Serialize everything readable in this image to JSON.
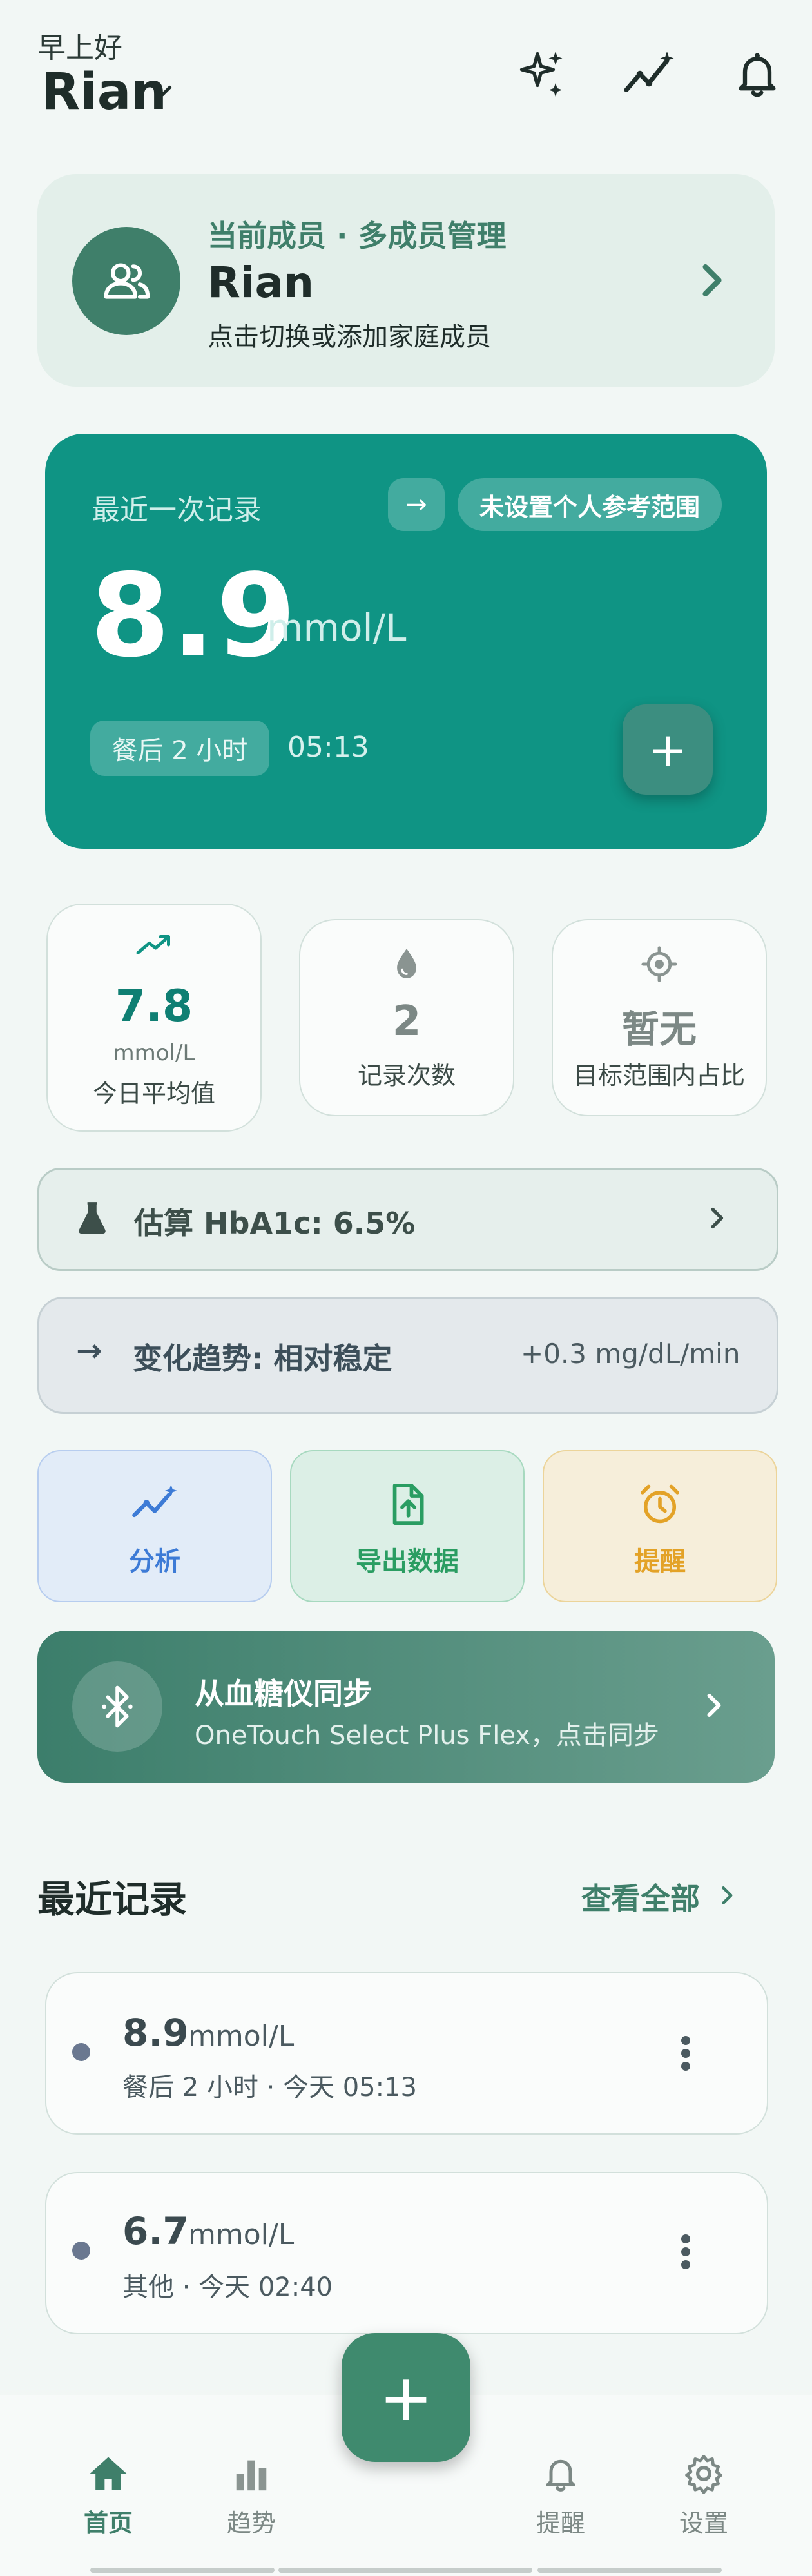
{
  "header": {
    "greeting": "早上好",
    "user_name": "Rian",
    "icons": [
      "sparkle-icon",
      "trend-icon",
      "bell-icon"
    ]
  },
  "member": {
    "subtitle": "当前成员 · 多成员管理",
    "name": "Rian",
    "hint": "点击切换或添加家庭成员"
  },
  "latest": {
    "label": "最近一次记录",
    "arrow": "→",
    "range_badge": "未设置个人参考范围",
    "value": "8.9",
    "unit": "mmol/L",
    "meal": "餐后 2 小时",
    "time": "05:13",
    "add": "+"
  },
  "stats": {
    "avg": {
      "value": "7.8",
      "unit": "mmol/L",
      "label": "今日平均值"
    },
    "count": {
      "value": "2",
      "label": "记录次数"
    },
    "range": {
      "value": "暂无",
      "label": "目标范围内占比"
    }
  },
  "hba1c": {
    "text": "估算 HbA1c: 6.5%"
  },
  "trend": {
    "arrow": "→",
    "text": "变化趋势: 相对稳定",
    "rate": "+0.3 mg/dL/min"
  },
  "actions": {
    "analyze": "分析",
    "export": "导出数据",
    "remind": "提醒"
  },
  "sync": {
    "title": "从血糖仪同步",
    "subtitle": "OneTouch Select Plus Flex，点击同步"
  },
  "recent": {
    "title": "最近记录",
    "view_all": "查看全部",
    "items": [
      {
        "value": "8.9",
        "unit": "mmol/L",
        "meta": "餐后 2 小时 · 今天 05:13"
      },
      {
        "value": "6.7",
        "unit": "mmol/L",
        "meta": "其他 · 今天 02:40"
      }
    ]
  },
  "nav": {
    "home": "首页",
    "trends": "趋势",
    "fab": "+",
    "alerts": "提醒",
    "settings": "设置"
  },
  "colors": {
    "primary": "#3f7f6a",
    "teal_card": "#0f9484",
    "analyze": "#3d7bd6",
    "export": "#2a9d62",
    "remind": "#e3a227"
  }
}
